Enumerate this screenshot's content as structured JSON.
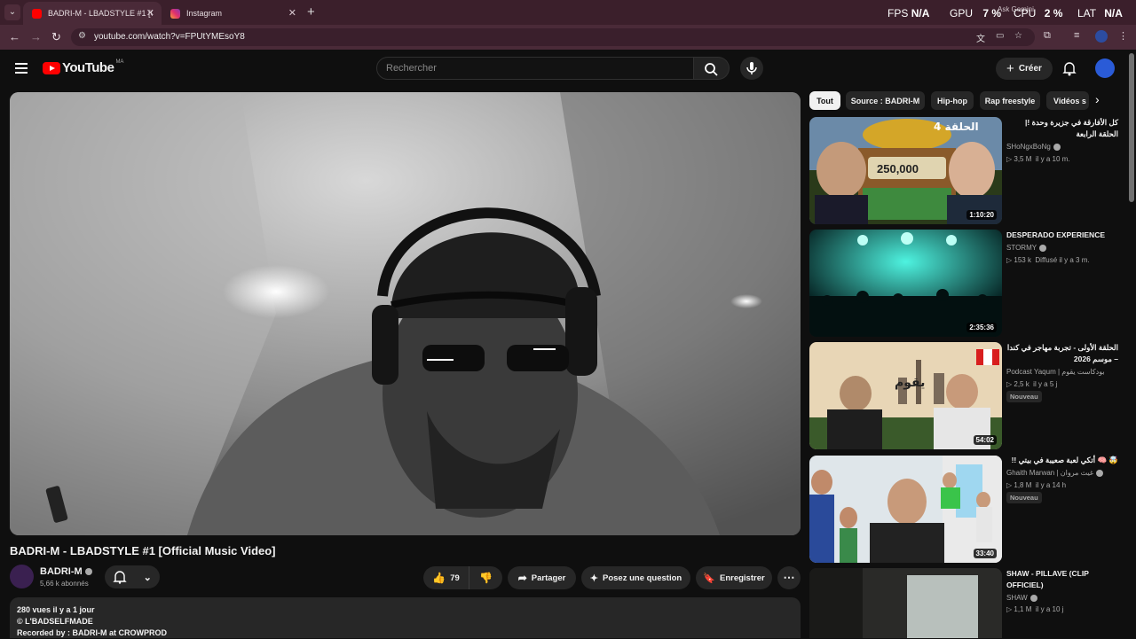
{
  "browser": {
    "tabs": [
      {
        "title": "BADRI-M - LBADSTYLE #1 [Offic",
        "favicon_color": "#ff0000"
      },
      {
        "title": "Instagram",
        "favicon_color": "#e1306c"
      }
    ],
    "new_tab": "+",
    "url": "youtube.com/watch?v=FPUtYMEsoY8",
    "ask_gemini": "Ask Gemini"
  },
  "perf_overlay": {
    "fps_label": "FPS",
    "fps_value": "N/A",
    "gpu_label": "GPU",
    "gpu_value": "7 %",
    "cpu_label": "CPU",
    "cpu_value": "2 %",
    "lat_label": "LAT",
    "lat_value": "N/A"
  },
  "youtube": {
    "logo_text": "YouTube",
    "country_code": "MA",
    "search_placeholder": "Rechercher",
    "create_label": "Créer",
    "accent": "#ff0000"
  },
  "video": {
    "title": "BADRI-M - LBADSTYLE #1 [Official Music Video]",
    "channel": "BADRI-M",
    "subscribers": "5,66 k abonnés",
    "likes": "79",
    "share_label": "Partager",
    "ask_label": "Posez une question",
    "save_label": "Enregistrer",
    "description": {
      "stats": "280 vues  il y a 1 jour",
      "line1": "© L'BADSELFMADE",
      "line2": "Recorded by : BADRI-M at CROWPROD"
    }
  },
  "chips": [
    "Tout",
    "Source : BADRI-M",
    "Hip-hop",
    "Rap freestyle",
    "Vidéos s"
  ],
  "recommendations": [
    {
      "title": "كل الأفارقة في جزيرة وحدة !| الحلقة الرابعة",
      "channel": "SHoNgxBoNg",
      "views": "3,5 M",
      "age": "il y a 10 m.",
      "duration": "1:10:20",
      "thumb_overlay_title": "الحلقة 4",
      "thumb_overlay_amount": "250,000",
      "badge": ""
    },
    {
      "title": "DESPERADO EXPERIENCE",
      "channel": "STORMY",
      "views": "153 k",
      "age": "Diffusé il y a 3 m.",
      "duration": "2:35:36",
      "badge": ""
    },
    {
      "title": "الحلقة الأولى - تجربة مهاجر في كندا – موسم 2026",
      "channel": "Podcast Yaqum | بودكاست يقوم",
      "views": "2,5 k",
      "age": "il y a 5 j",
      "duration": "54:02",
      "thumb_overlay_title": "يقوم",
      "badge": "Nouveau"
    },
    {
      "title": "🤯 🧠 أتكي لعبة صعيبة في بيتي !!",
      "channel": "Ghaith Marwan | غيث مروان",
      "views": "1,8 M",
      "age": "il y a 14 h",
      "duration": "33:40",
      "badge": "Nouveau"
    },
    {
      "title": "SHAW - PILLAVE (CLIP OFFICIEL)",
      "channel": "SHAW",
      "views": "1,1 M",
      "age": "il y a 10 j",
      "duration": "",
      "badge": ""
    }
  ]
}
